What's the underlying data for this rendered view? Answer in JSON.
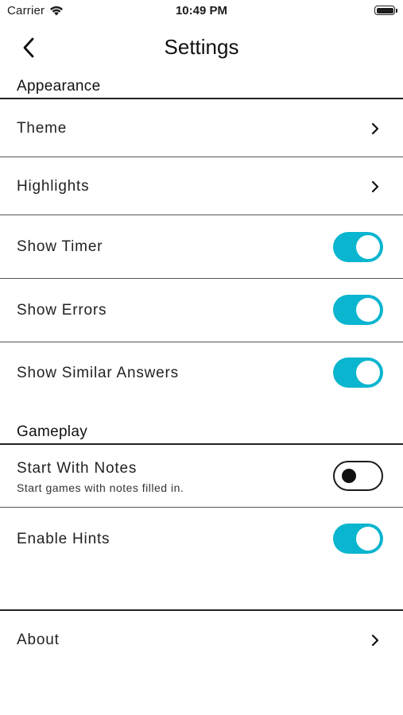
{
  "status_bar": {
    "carrier": "Carrier",
    "time": "10:49 PM",
    "wifi_icon": "wifi-icon",
    "battery_icon": "battery-icon"
  },
  "nav": {
    "title": "Settings",
    "back_icon": "chevron-left-icon"
  },
  "colors": {
    "accent": "#0ab5cf",
    "text": "#222222",
    "divider": "#222222"
  },
  "sections": {
    "appearance": {
      "title": "Appearance",
      "rows": {
        "theme": {
          "label": "Theme",
          "accessory": "chevron-right-icon"
        },
        "highlights": {
          "label": "Highlights",
          "accessory": "chevron-right-icon"
        },
        "show_timer": {
          "label": "Show Timer",
          "toggle": true
        },
        "show_errors": {
          "label": "Show Errors",
          "toggle": true
        },
        "show_similar_answers": {
          "label": "Show Similar Answers",
          "toggle": true
        }
      }
    },
    "gameplay": {
      "title": "Gameplay",
      "rows": {
        "start_with_notes": {
          "label": "Start With Notes",
          "subtitle": "Start games with notes filled in.",
          "toggle": false
        },
        "enable_hints": {
          "label": "Enable Hints",
          "toggle": true
        }
      }
    },
    "other": {
      "rows": {
        "about": {
          "label": "About",
          "accessory": "chevron-right-icon"
        }
      }
    }
  }
}
